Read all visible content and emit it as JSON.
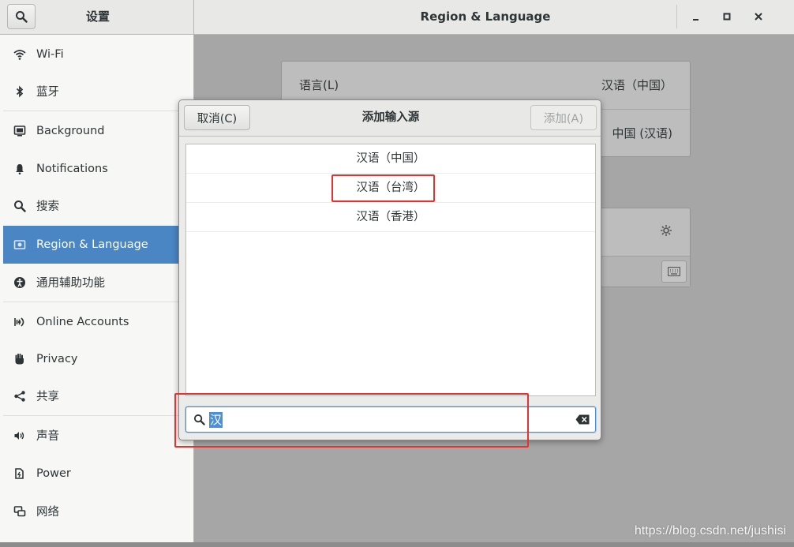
{
  "headerbar": {
    "left_title": "设置",
    "right_title": "Region & Language"
  },
  "sidebar": {
    "items": [
      {
        "label": "Wi-Fi",
        "icon": "wifi-icon"
      },
      {
        "label": "蓝牙",
        "icon": "bluetooth-icon"
      },
      {
        "label": "Background",
        "icon": "background-icon"
      },
      {
        "label": "Notifications",
        "icon": "bell-icon"
      },
      {
        "label": "搜索",
        "icon": "search-icon"
      },
      {
        "label": "Region & Language",
        "icon": "region-flag-icon",
        "selected": true
      },
      {
        "label": "通用辅助功能",
        "icon": "accessibility-icon"
      },
      {
        "label": "Online Accounts",
        "icon": "online-accounts-icon"
      },
      {
        "label": "Privacy",
        "icon": "hand-icon"
      },
      {
        "label": "共享",
        "icon": "share-icon"
      },
      {
        "label": "声音",
        "icon": "speaker-icon"
      },
      {
        "label": "Power",
        "icon": "power-icon"
      },
      {
        "label": "网络",
        "icon": "network-icon"
      }
    ]
  },
  "main": {
    "language_label": "语言(L)",
    "language_value": "汉语（中国）",
    "formats_value": "中国 (汉语)"
  },
  "dialog": {
    "cancel_label": "取消(C)",
    "title": "添加输入源",
    "add_label": "添加(A)",
    "options": [
      "汉语（中国）",
      "汉语（台湾）",
      "汉语（香港）"
    ],
    "search_value": "汉"
  },
  "watermark": "https://blog.csdn.net/jushisi",
  "colors": {
    "selection_accent": "#4a85c4",
    "annotation_red": "#e8312e",
    "focus_blue": "#4a90d9"
  }
}
